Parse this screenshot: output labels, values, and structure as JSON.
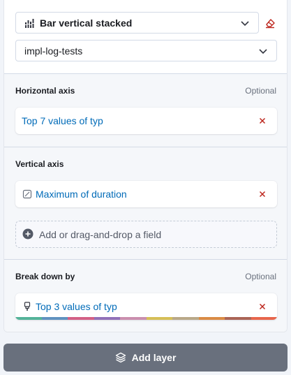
{
  "visualization_select": {
    "label": "Bar vertical stacked",
    "icon": "bar-vertical-stacked-icon"
  },
  "clear_layer": {
    "icon": "eraser-icon"
  },
  "index_select": {
    "label": "impl-log-tests"
  },
  "sections": {
    "horizontal": {
      "title": "Horizontal axis",
      "optional": "Optional",
      "dimension": {
        "label": "Top 7 values of typ"
      }
    },
    "vertical": {
      "title": "Vertical axis",
      "dimension": {
        "label": "Maximum of duration",
        "icon": "invalid-field-icon"
      },
      "add_field": "Add or drag-and-drop a field"
    },
    "breakdown": {
      "title": "Break down by",
      "optional": "Optional",
      "dimension": {
        "label": "Top 3 values of typ",
        "icon": "brush-icon"
      }
    }
  },
  "palette_colors": [
    "#54b399",
    "#6092c0",
    "#d36086",
    "#9170b8",
    "#ca8eae",
    "#d6bf57",
    "#b9a888",
    "#da8b45",
    "#aa6556",
    "#e7664c"
  ],
  "colors": {
    "accent": "#006bb8",
    "danger": "#bd271e",
    "button": "#69707d"
  },
  "add_layer_button": {
    "label": "Add layer",
    "icon": "layers-icon"
  }
}
